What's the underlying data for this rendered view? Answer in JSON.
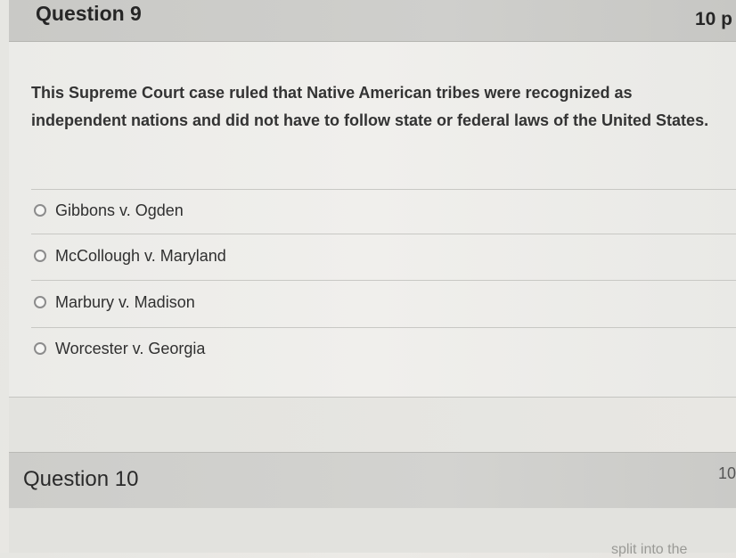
{
  "question9": {
    "title": "Question 9",
    "points": "10 p",
    "text": "This Supreme Court case ruled that Native American tribes were recognized as independent nations and did not have to follow state or federal laws of the United States.",
    "answers": [
      {
        "label": "Gibbons v. Ogden",
        "selected": false
      },
      {
        "label": "McCollough v. Maryland",
        "selected": false
      },
      {
        "label": "Marbury v. Madison",
        "selected": false
      },
      {
        "label": "Worcester v. Georgia",
        "selected": false
      }
    ]
  },
  "question10": {
    "title": "Question 10",
    "points": "10",
    "text_fragment": "split into the"
  },
  "colors": {
    "header_bg": "#cbcbc8",
    "body_bg": "#eeede9",
    "radio_border": "#8c8c8c",
    "text": "#2d2d2d"
  }
}
